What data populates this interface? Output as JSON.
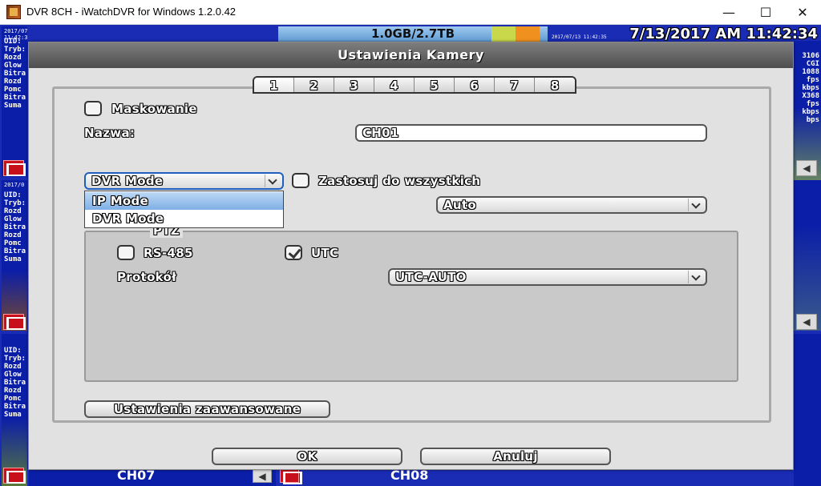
{
  "window": {
    "title": "DVR 8CH - iWatchDVR for Windows 1.2.0.42",
    "minimize": "—",
    "maximize": "☐",
    "close": "✕"
  },
  "background": {
    "storage": "1.0GB/2.7TB",
    "datetime": "7/13/2017 AM 11:42:34",
    "cam_timestamp": "2017/07/13 11:42:35",
    "cam_timestamp_right": "2017/07/13 11:42:35",
    "info_labels": [
      "UID:",
      "Tryb:",
      "Rozd",
      "Glow",
      "Bitra",
      "Rozd",
      "Pomc",
      "Bitra",
      "Suma"
    ],
    "info_labels_cam2": [
      "UID:",
      "Tryb:",
      "Rozd",
      "Glow",
      "Bitra",
      "Rozd",
      "Pomc",
      "Bitra",
      "Suma"
    ],
    "info_labels_cam3": [
      "UID:",
      "Tryb:",
      "Rozd",
      "Glow",
      "Bitra",
      "Rozd",
      "Pomc",
      "Bitra",
      "Suma"
    ],
    "right_values": [
      "3106",
      "CGI",
      "1088",
      "fps",
      "kbps",
      "X368",
      "fps",
      "kbps",
      "bps"
    ],
    "ch07": "CH07",
    "ch08": "CH08",
    "cam2_timestamp": "2017/0"
  },
  "dialog": {
    "title": "Ustawienia Kamery",
    "tabs": [
      "1",
      "2",
      "3",
      "4",
      "5",
      "6",
      "7",
      "8"
    ],
    "active_tab": "1",
    "masking_label": "Maskowanie",
    "masking_checked": false,
    "name_label": "Nazwa:",
    "name_value": "CH01",
    "mode_selected": "DVR Mode",
    "mode_options": [
      "IP Mode",
      "DVR Mode"
    ],
    "apply_all_label": "Zastosuj do wszystkich",
    "apply_all_checked": false,
    "auto_value": "Auto",
    "ptz_label": "PTZ",
    "rs485_label": "RS-485",
    "rs485_checked": false,
    "utc_label": "UTC",
    "utc_checked": true,
    "protocol_label": "Protokół",
    "protocol_value": "UTC-AUTO",
    "advanced_button": "Ustawienia zaawansowane",
    "ok_button": "OK",
    "cancel_button": "Anuluj"
  }
}
